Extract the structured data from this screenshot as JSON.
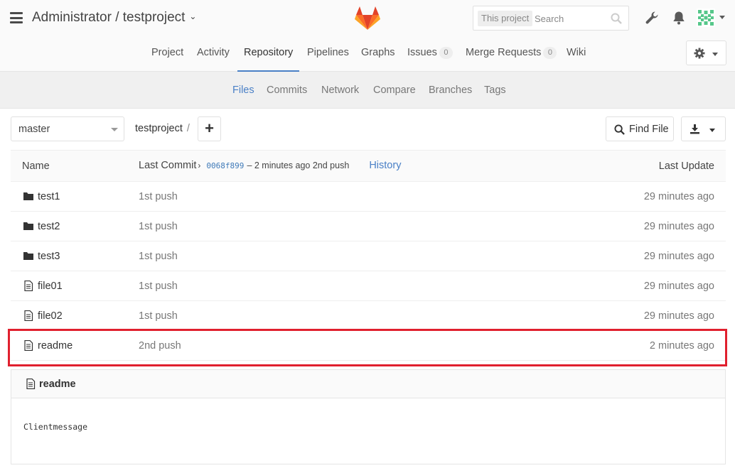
{
  "header": {
    "title": "Administrator / testproject",
    "search": {
      "scope": "This project",
      "placeholder": "Search"
    }
  },
  "nav": {
    "tabs": [
      {
        "label": "Project"
      },
      {
        "label": "Activity"
      },
      {
        "label": "Repository",
        "active": true
      },
      {
        "label": "Pipelines"
      },
      {
        "label": "Graphs"
      },
      {
        "label": "Issues",
        "count": "0"
      },
      {
        "label": "Merge Requests",
        "count": "0"
      },
      {
        "label": "Wiki"
      }
    ]
  },
  "subnav": {
    "items": [
      {
        "label": "Files",
        "active": true
      },
      {
        "label": "Commits"
      },
      {
        "label": "Network"
      },
      {
        "label": "Compare"
      },
      {
        "label": "Branches"
      },
      {
        "label": "Tags"
      }
    ]
  },
  "toolbar": {
    "branch": "master",
    "path": "testproject",
    "path_sep": "/",
    "plus": "+",
    "find_file": "Find File"
  },
  "table": {
    "headers": {
      "name": "Name",
      "last_commit": "Last Commit",
      "commit_sha": "0068f899",
      "commit_msg": "– 2 minutes ago 2nd push",
      "history": "History",
      "last_update": "Last Update"
    },
    "rows": [
      {
        "type": "folder",
        "name": "test1",
        "message": "1st push",
        "updated": "29 minutes ago"
      },
      {
        "type": "folder",
        "name": "test2",
        "message": "1st push",
        "updated": "29 minutes ago"
      },
      {
        "type": "folder",
        "name": "test3",
        "message": "1st push",
        "updated": "29 minutes ago"
      },
      {
        "type": "file",
        "name": "file01",
        "message": "1st push",
        "updated": "29 minutes ago"
      },
      {
        "type": "file",
        "name": "file02",
        "message": "1st push",
        "updated": "29 minutes ago"
      },
      {
        "type": "file",
        "name": "readme",
        "message": "2nd push",
        "updated": "2 minutes ago"
      }
    ]
  },
  "readme": {
    "title": "readme",
    "content": "Clientmessage"
  },
  "colors": {
    "accent": "#4a80c6",
    "highlight": "#e0202e"
  }
}
